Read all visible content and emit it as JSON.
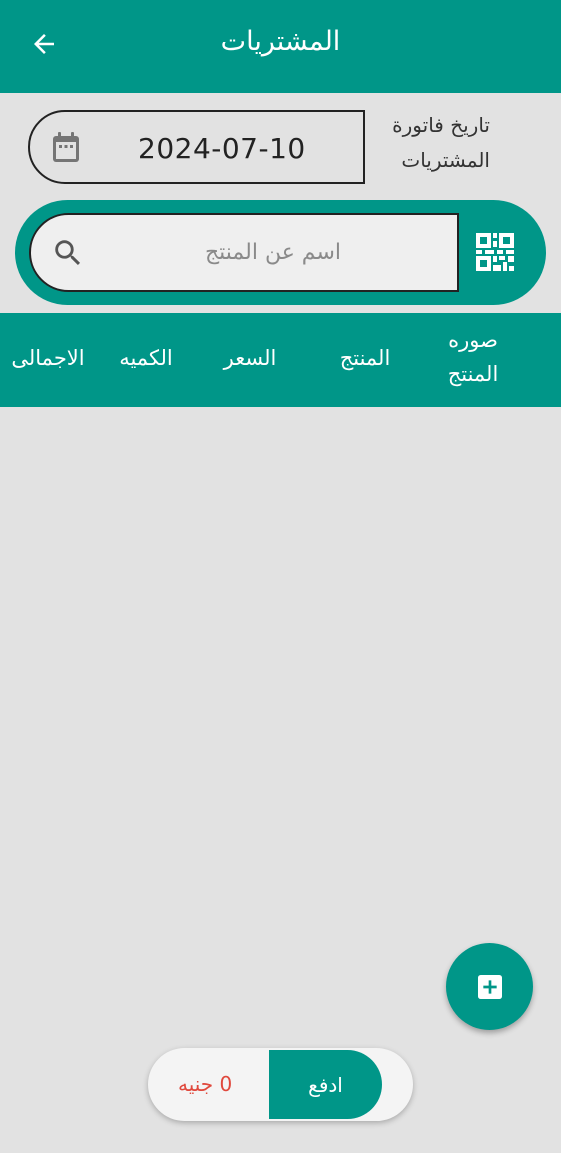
{
  "header": {
    "title": "المشتريات",
    "back_icon": "arrow-left-icon"
  },
  "invoice_date": {
    "label": "تاريخ فاتورة المشتريات",
    "value": "2024-07-10",
    "icon": "calendar-icon"
  },
  "search": {
    "placeholder": "اسم عن المنتج",
    "search_icon": "search-icon",
    "scan_icon": "qr-code-icon"
  },
  "table": {
    "columns": [
      "صوره المنتج",
      "المنتج",
      "السعر",
      "الكميه",
      "الاجمالى"
    ]
  },
  "fab": {
    "icon": "add-box-icon"
  },
  "footer": {
    "pay_label": "ادفع",
    "total": "0 جنيه"
  },
  "colors": {
    "primary": "#009688",
    "background": "#e2e2e2",
    "total_text": "#e0483c"
  }
}
